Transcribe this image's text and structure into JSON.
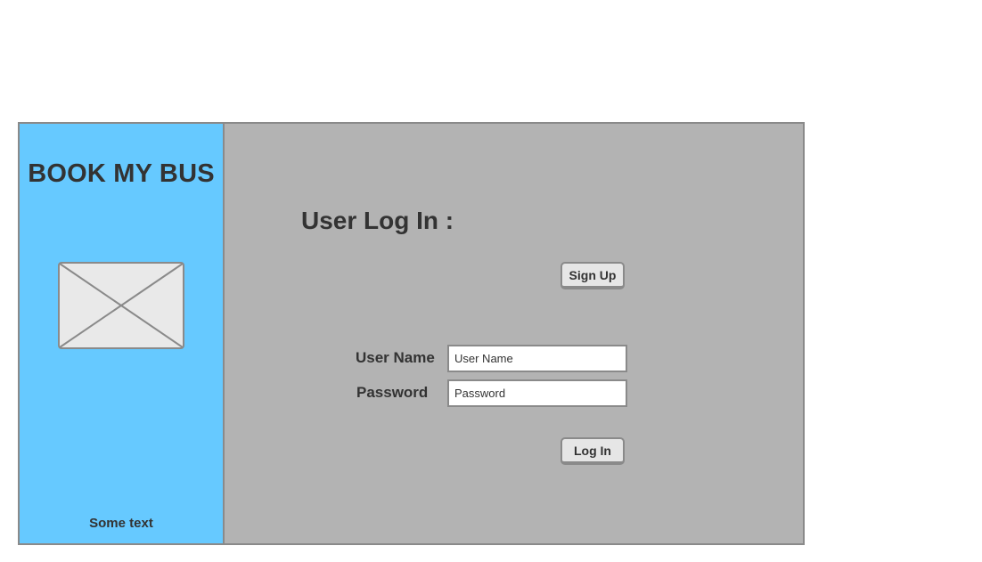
{
  "sidebar": {
    "app_title": "BOOK MY BUS",
    "image_icon": "image-placeholder-icon",
    "footer_text": "Some text"
  },
  "main": {
    "title": "User Log In :",
    "signup_label": "Sign Up",
    "login_label": "Log In",
    "fields": {
      "username": {
        "label": "User Name",
        "placeholder": "User Name",
        "value": ""
      },
      "password": {
        "label": "Password",
        "placeholder": "Password",
        "value": ""
      }
    }
  },
  "colors": {
    "sidebar_bg": "#66c9ff",
    "main_bg": "#b3b3b3",
    "border": "#8a8a8a",
    "text": "#333333",
    "button_bg": "#e6e6e6"
  }
}
